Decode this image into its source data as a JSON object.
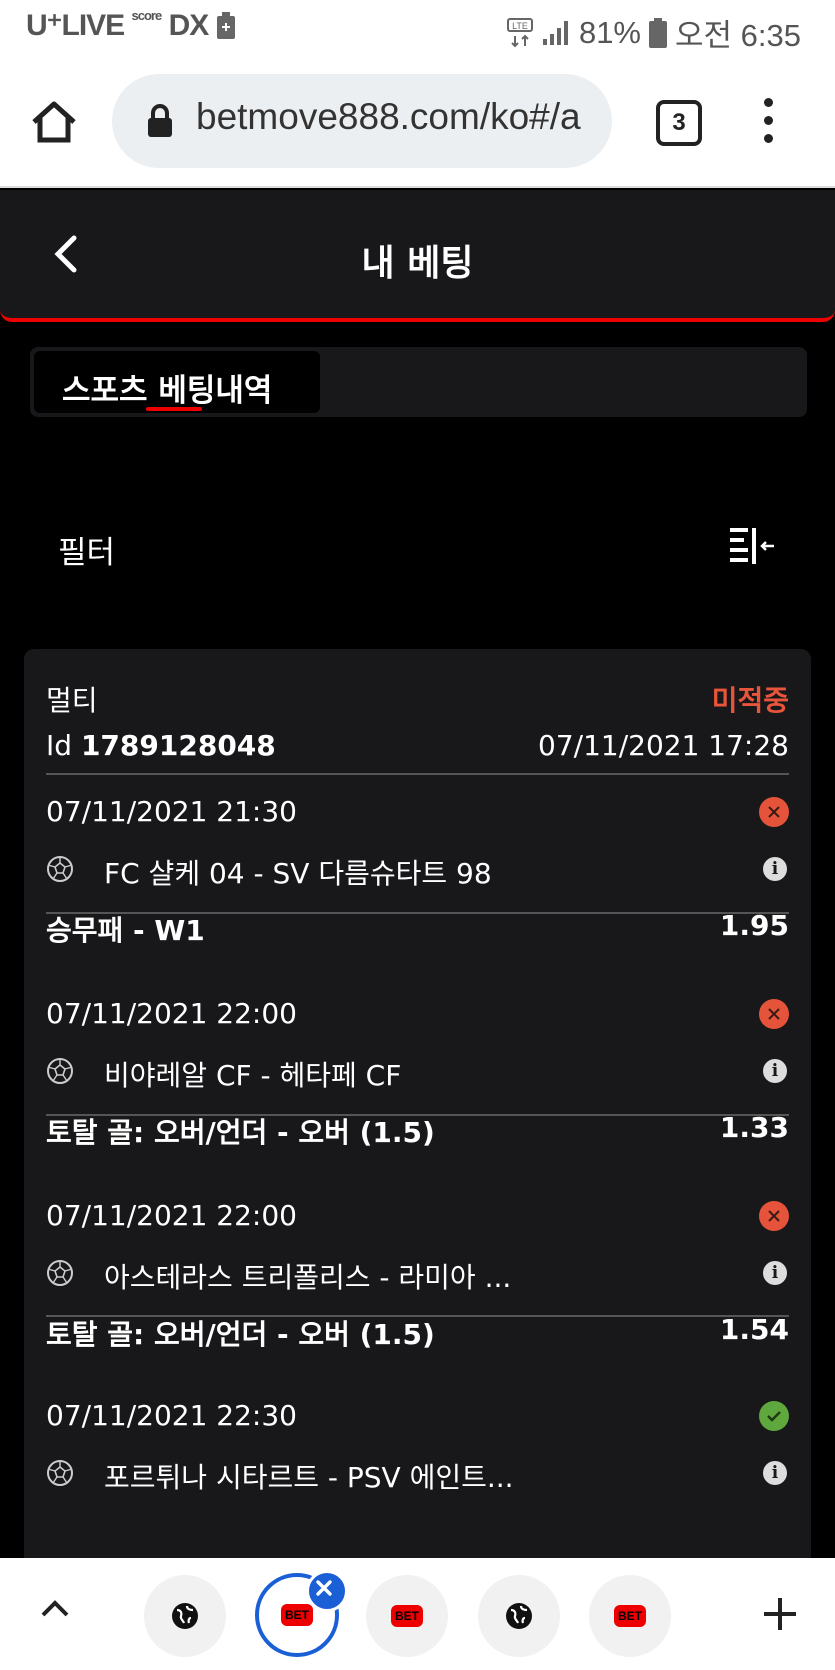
{
  "statusbar": {
    "carrier_logo": "U⁺LIVE",
    "carrier_sub": "score",
    "carrier_dx": "DX",
    "battery": "81%",
    "time": "오전 6:35"
  },
  "browser": {
    "url": "betmove888.com/ko#/a",
    "tab_count": "3"
  },
  "header": {
    "title": "내 베팅"
  },
  "tabs": [
    {
      "label": "스포츠 베팅내역"
    }
  ],
  "filter": {
    "label": "필터"
  },
  "bet": {
    "type": "멀티",
    "status": "미적중",
    "id_prefix": "Id",
    "id": "1789128048",
    "placed": "07/11/2021 17:28",
    "legs": [
      {
        "time": "07/11/2021 21:30",
        "result": "lost",
        "match": "FC 샬케 04 - SV 다름슈타트 98",
        "market": "승무패 - W1",
        "odds": "1.95"
      },
      {
        "time": "07/11/2021 22:00",
        "result": "lost",
        "match": "비야레알 CF - 헤타페 CF",
        "market": "토탈 골: 오버/언더 - 오버 (1.5)",
        "odds": "1.33"
      },
      {
        "time": "07/11/2021 22:00",
        "result": "lost",
        "match": "아스테라스 트리폴리스 - 라미아 ...",
        "market": "토탈 골: 오버/언더 - 오버 (1.5)",
        "odds": "1.54"
      },
      {
        "time": "07/11/2021 22:30",
        "result": "won",
        "match": "포르튀나 시타르트 - PSV 에인트...",
        "market": "",
        "odds": ""
      }
    ]
  },
  "bottombar": {
    "bet_label": "BET"
  },
  "colors": {
    "accent": "#e00000",
    "lost": "#e5543a",
    "won": "#5fa83d",
    "selected_tab_border": "#1a5fd6"
  }
}
